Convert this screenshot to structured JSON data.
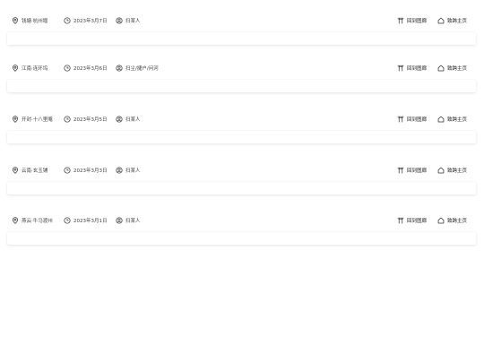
{
  "entries": [
    {
      "location": "钱塘·杭州堰",
      "date": "2023年3月7日",
      "person": "扫某人",
      "actions": {
        "gallery": "回到图廊",
        "home": "致跨主页"
      }
    },
    {
      "location": "江南·连环坞",
      "date": "2023年3月6日",
      "person": "扫尘/捷户/问河",
      "actions": {
        "gallery": "回到图廊",
        "home": "致跨主页"
      }
    },
    {
      "location": "开封·十八里庵",
      "date": "2023年3月5日",
      "person": "扫某人",
      "actions": {
        "gallery": "回到图廊",
        "home": "致跨主页"
      }
    },
    {
      "location": "云南·玄玉铺",
      "date": "2023年3月3日",
      "person": "扫某人",
      "actions": {
        "gallery": "回到图廊",
        "home": "致跨主页"
      }
    },
    {
      "location": "燕云·牛马渡州",
      "date": "2023年3月1日",
      "person": "扫某人",
      "actions": {
        "gallery": "回到图廊",
        "home": "致跨主页"
      }
    }
  ],
  "icons": {
    "location": "location-pin-icon",
    "date": "clock-icon",
    "person": "user-icon",
    "gallery": "torii-gate-icon",
    "home": "home-icon"
  }
}
